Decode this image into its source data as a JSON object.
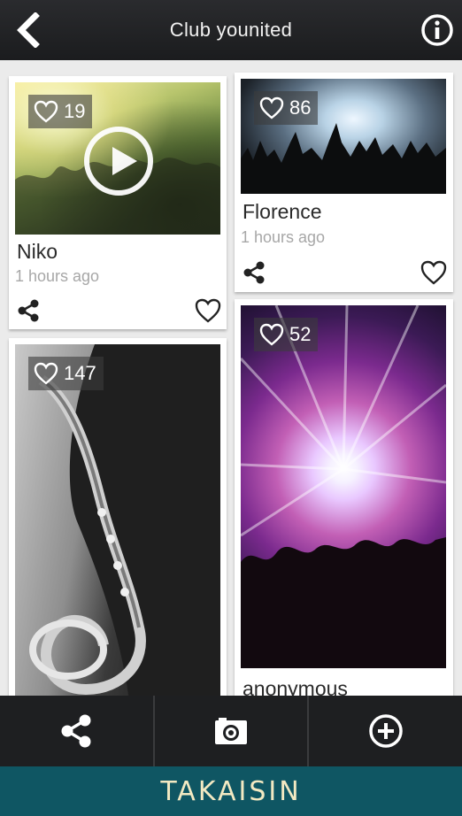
{
  "header": {
    "title": "Club younited",
    "back_icon": "back-chevron-icon",
    "info_icon": "info-icon"
  },
  "cards": [
    {
      "likes": "19",
      "name": "Niko",
      "time": "1 hours ago"
    },
    {
      "likes": "86",
      "name": "Florence",
      "time": "1 hours ago"
    },
    {
      "likes": "147"
    },
    {
      "likes": "52",
      "name": "anonymous"
    }
  ],
  "bottom_bar": {
    "share_icon": "share-icon",
    "camera_icon": "camera-icon",
    "add_icon": "add-circle-icon"
  },
  "footer": {
    "brand": "TAKAISIN"
  },
  "colors": {
    "top_bar": "#1f2022",
    "footer": "#0f5663",
    "footer_text": "#f3e9c2",
    "feed_bg": "#ebebeb"
  }
}
